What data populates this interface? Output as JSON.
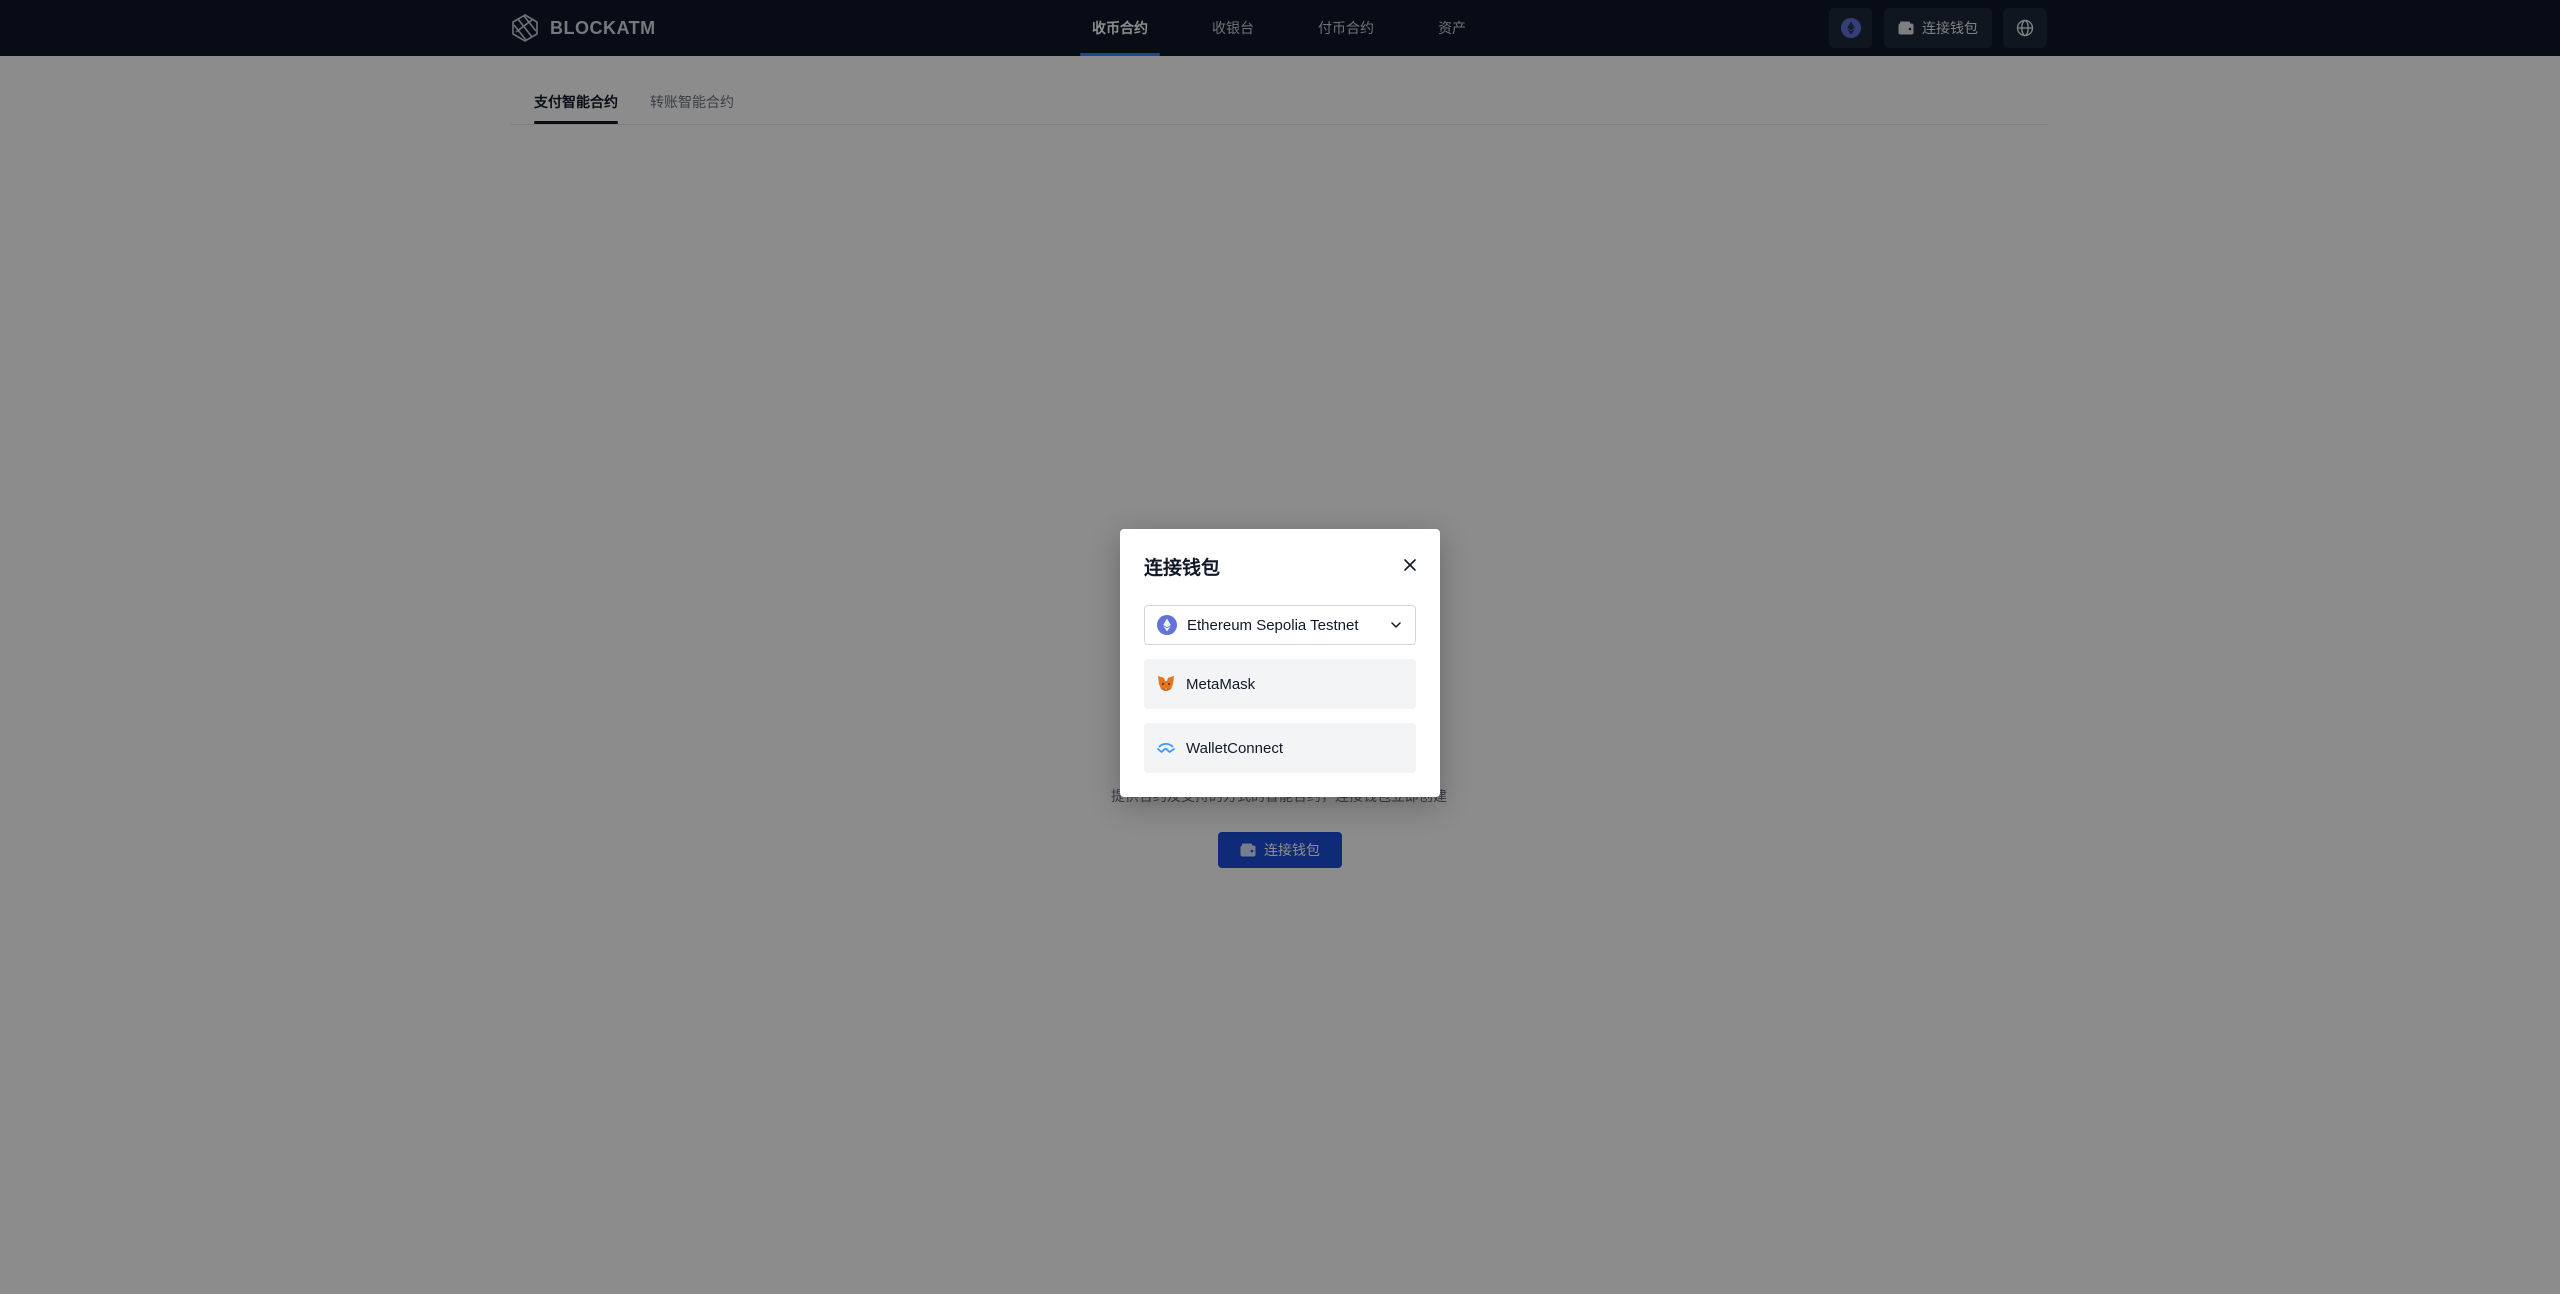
{
  "header": {
    "brand": "BLOCKATM",
    "nav": [
      {
        "label": "收币合约",
        "active": true
      },
      {
        "label": "收银台",
        "active": false
      },
      {
        "label": "付币合约",
        "active": false
      },
      {
        "label": "资产",
        "active": false
      }
    ],
    "connect_wallet_label": "连接钱包"
  },
  "main": {
    "tabs": [
      {
        "label": "支付智能合约",
        "active": true
      },
      {
        "label": "转账智能合约",
        "active": false
      }
    ],
    "empty_hint": "提供合约及支持的方式的智能合约，连接钱包立即创建",
    "connect_wallet_button": "连接钱包"
  },
  "modal": {
    "title": "连接钱包",
    "network": {
      "selected": "Ethereum Sepolia Testnet",
      "icon": "ethereum-icon"
    },
    "wallets": [
      {
        "label": "MetaMask",
        "icon": "metamask-icon"
      },
      {
        "label": "WalletConnect",
        "icon": "walletconnect-icon"
      }
    ]
  },
  "colors": {
    "header_bg": "#0f172a",
    "accent": "#1d4ed8",
    "overlay": "rgba(0,0,0,0.45)"
  }
}
